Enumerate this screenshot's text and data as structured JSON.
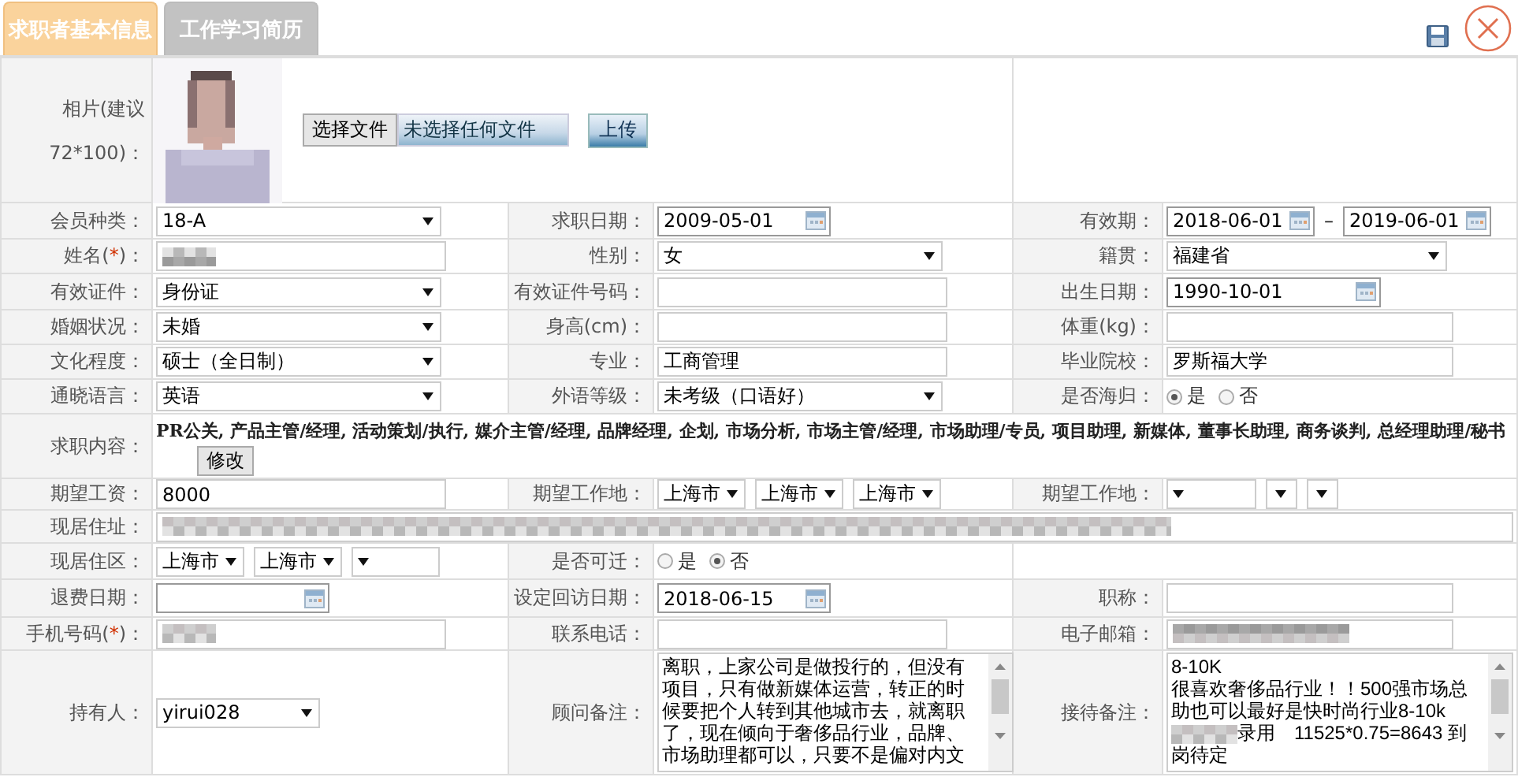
{
  "tabs": [
    {
      "label": "求职者基本信息",
      "selected": true
    },
    {
      "label": "工作学习简历",
      "selected": false
    }
  ],
  "form": {
    "rows": [
      {
        "cells": [
          {
            "kind": "label",
            "text": "相片(建议72*100)："
          },
          {
            "choose_button": "选择文件",
            "file_status": "未选择任何文件",
            "upload_button": "上传"
          },
          {
            "kind": "blank"
          }
        ]
      },
      {
        "cells": [
          {
            "kind": "label",
            "text": "会员种类："
          },
          {
            "kind": "select",
            "value": "18-A"
          },
          {
            "kind": "label",
            "text": "求职日期："
          },
          {
            "kind": "date",
            "value": "2009-05-01"
          },
          {
            "kind": "label",
            "text": "有效期："
          },
          {
            "kind": "date-range",
            "from": "2018-06-01",
            "separator": "–",
            "to": "2019-06-01"
          }
        ]
      },
      {
        "cells": [
          {
            "kind": "label",
            "text": "姓名(",
            "star": "*",
            "rest": ")："
          },
          {
            "kind": "redacted"
          },
          {
            "kind": "label",
            "text": "性别："
          },
          {
            "kind": "select",
            "value": "女"
          },
          {
            "kind": "label",
            "text": "籍贯："
          },
          {
            "kind": "select",
            "value": "福建省"
          }
        ]
      },
      {
        "cells": [
          {
            "kind": "label",
            "text": "有效证件："
          },
          {
            "kind": "select",
            "value": "身份证"
          },
          {
            "kind": "label",
            "text": "有效证件号码："
          },
          {
            "kind": "input"
          },
          {
            "kind": "label",
            "text": "出生日期："
          },
          {
            "kind": "date",
            "value": "1990-10-01"
          }
        ]
      },
      {
        "cells": [
          {
            "kind": "label",
            "text": "婚姻状况："
          },
          {
            "kind": "select",
            "value": "未婚"
          },
          {
            "kind": "label",
            "text": "身高(cm)："
          },
          {
            "kind": "input"
          },
          {
            "kind": "label",
            "text": "体重(kg)："
          },
          {
            "kind": "input"
          }
        ]
      },
      {
        "cells": [
          {
            "kind": "label",
            "text": "文化程度："
          },
          {
            "kind": "select",
            "value": "硕士（全日制）"
          },
          {
            "kind": "label",
            "text": "专业："
          },
          {
            "kind": "input",
            "value": "工商管理"
          },
          {
            "kind": "label",
            "text": "毕业院校："
          },
          {
            "kind": "input",
            "value": "罗斯福大学"
          }
        ]
      },
      {
        "cells": [
          {
            "kind": "label",
            "text": "通晓语言："
          },
          {
            "kind": "select",
            "value": "英语"
          },
          {
            "kind": "label",
            "text": "外语等级："
          },
          {
            "kind": "select",
            "value": "未考级（口语好）"
          },
          {
            "kind": "label",
            "text": "是否海归："
          },
          {
            "kind": "radio",
            "options": [
              {
                "label": "是",
                "selected": true
              },
              {
                "label": "否",
                "selected": false
              }
            ]
          }
        ]
      },
      {
        "cells": [
          {
            "kind": "label",
            "text": "求职内容："
          },
          {
            "kind": "tags",
            "text": "PR公关, 产品主管/经理, 活动策划/执行, 媒介主管/经理, 品牌经理, 企划, 市场分析, 市场主管/经理, 市场助理/专员, 项目助理, 新媒体, 董事长助理, 商务谈判, 总经理助理/秘书",
            "button": "修改"
          }
        ]
      },
      {
        "cells": [
          {
            "kind": "label",
            "text": "期望工资："
          },
          {
            "kind": "input",
            "value": "8000"
          },
          {
            "kind": "label",
            "text": "期望工作地："
          },
          {
            "kind": "selects",
            "items": [
              {
                "kind": "select",
                "value": "上海市"
              },
              {
                "kind": "select",
                "value": "上海市"
              },
              {
                "kind": "select",
                "value": "上海市"
              }
            ]
          },
          {
            "kind": "label",
            "text": "期望工作地："
          },
          {
            "kind": "selects",
            "items": [
              {
                "kind": "select"
              },
              {
                "kind": "select"
              },
              {
                "kind": "select"
              }
            ]
          }
        ]
      },
      {
        "cells": [
          {
            "kind": "label",
            "text": "现居住址："
          },
          {
            "kind": "redacted"
          }
        ]
      },
      {
        "cells": [
          {
            "kind": "label",
            "text": "现居住区："
          },
          {
            "kind": "selects",
            "items": [
              {
                "kind": "select",
                "value": "上海市"
              },
              {
                "kind": "select",
                "value": "上海市"
              },
              {
                "kind": "select"
              }
            ]
          },
          {
            "kind": "label",
            "text": "是否可迁："
          },
          {
            "kind": "radio",
            "options": [
              {
                "label": "是",
                "selected": false
              },
              {
                "label": "否",
                "selected": true
              }
            ]
          },
          {
            "kind": "blank"
          }
        ]
      },
      {
        "cells": [
          {
            "kind": "label",
            "text": "退费日期："
          },
          {
            "kind": "date"
          },
          {
            "kind": "label",
            "text": "设定回访日期："
          },
          {
            "kind": "date",
            "value": "2018-06-15"
          },
          {
            "kind": "label",
            "text": "职称："
          },
          {
            "kind": "input"
          }
        ]
      },
      {
        "cells": [
          {
            "kind": "label",
            "text": "手机号码(",
            "star": "*",
            "rest": ")："
          },
          {
            "kind": "redacted"
          },
          {
            "kind": "label",
            "text": "联系电话："
          },
          {
            "kind": "input"
          },
          {
            "kind": "label",
            "text": "电子邮箱："
          },
          {
            "kind": "redacted"
          }
        ]
      },
      {
        "cells": [
          {
            "kind": "label",
            "text": "持有人："
          },
          {
            "kind": "select",
            "value": "yirui028"
          },
          {
            "kind": "label",
            "text": "顾问备注："
          },
          {
            "kind": "textarea",
            "segments": [
              {
                "kind": "text",
                "text": "离职，上家公司是做投行的，但没有项目，只有做新媒体运营，转正的时候要把个人转到其他城市去，就离职了，现在倾向于奢侈品行业，品牌、市场助理都可以，只要不是偏对内文"
              }
            ]
          },
          {
            "kind": "label",
            "text": "接待备注："
          },
          {
            "kind": "textarea",
            "segments": [
              {
                "kind": "text",
                "text": "8-10K\n很喜欢奢侈品行业！！500强市场总助也可以最好是快时尚行业8-10k\n"
              },
              {
                "kind": "redacted"
              },
              {
                "kind": "text",
                "text": "录用　11525*0.75=8643 到岗待定"
              }
            ]
          }
        ]
      }
    ]
  }
}
